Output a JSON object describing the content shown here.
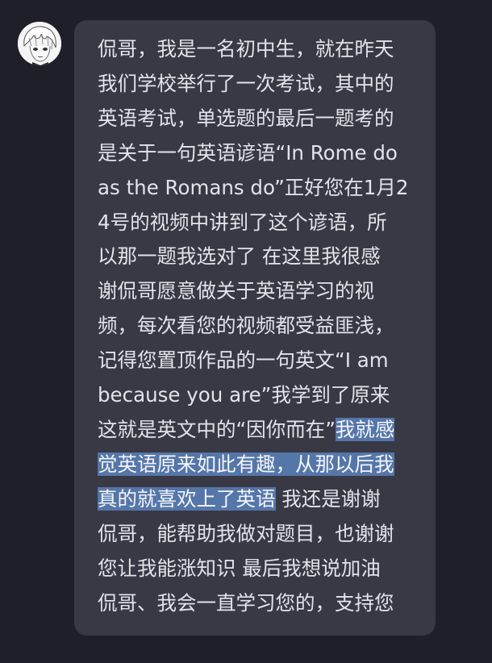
{
  "message": {
    "lines": [
      [
        {
          "text": "侃哥，我是一名初中生，就在昨天",
          "hl": false
        }
      ],
      [
        {
          "text": "我们学校举行了一次考试，其中的",
          "hl": false
        }
      ],
      [
        {
          "text": "英语考试，单选题的最后一题考的",
          "hl": false
        }
      ],
      [
        {
          "text": "是关于一句英语谚语“In Rome do",
          "hl": false
        }
      ],
      [
        {
          "text": "as the Romans do”正好您在1月2",
          "hl": false
        }
      ],
      [
        {
          "text": "4号的视频中讲到了这个谚语，所",
          "hl": false
        }
      ],
      [
        {
          "text": "以那一题我选对了 在这里我很感",
          "hl": false
        }
      ],
      [
        {
          "text": "谢侃哥愿意做关于英语学习的视",
          "hl": false
        }
      ],
      [
        {
          "text": "频，每次看您的视频都受益匪浅，",
          "hl": false
        }
      ],
      [
        {
          "text": "记得您置顶作品的一句英文“I am",
          "hl": false
        }
      ],
      [
        {
          "text": "because you are”我学到了原来",
          "hl": false
        }
      ],
      [
        {
          "text": "这就是英文中的“因你而在”",
          "hl": false
        },
        {
          "text": "我就感",
          "hl": true
        }
      ],
      [
        {
          "text": "觉英语原来如此有趣，从那以后我",
          "hl": true
        }
      ],
      [
        {
          "text": "真的就喜欢上了英语",
          "hl": true
        },
        {
          "text": " 我还是谢谢",
          "hl": false
        }
      ],
      [
        {
          "text": "侃哥，能帮助我做对题目，也谢谢",
          "hl": false
        }
      ],
      [
        {
          "text": "您让我能涨知识 最后我想说加油",
          "hl": false
        }
      ],
      [
        {
          "text": "侃哥、我会一直学习您的，支持您",
          "hl": false
        }
      ]
    ]
  }
}
